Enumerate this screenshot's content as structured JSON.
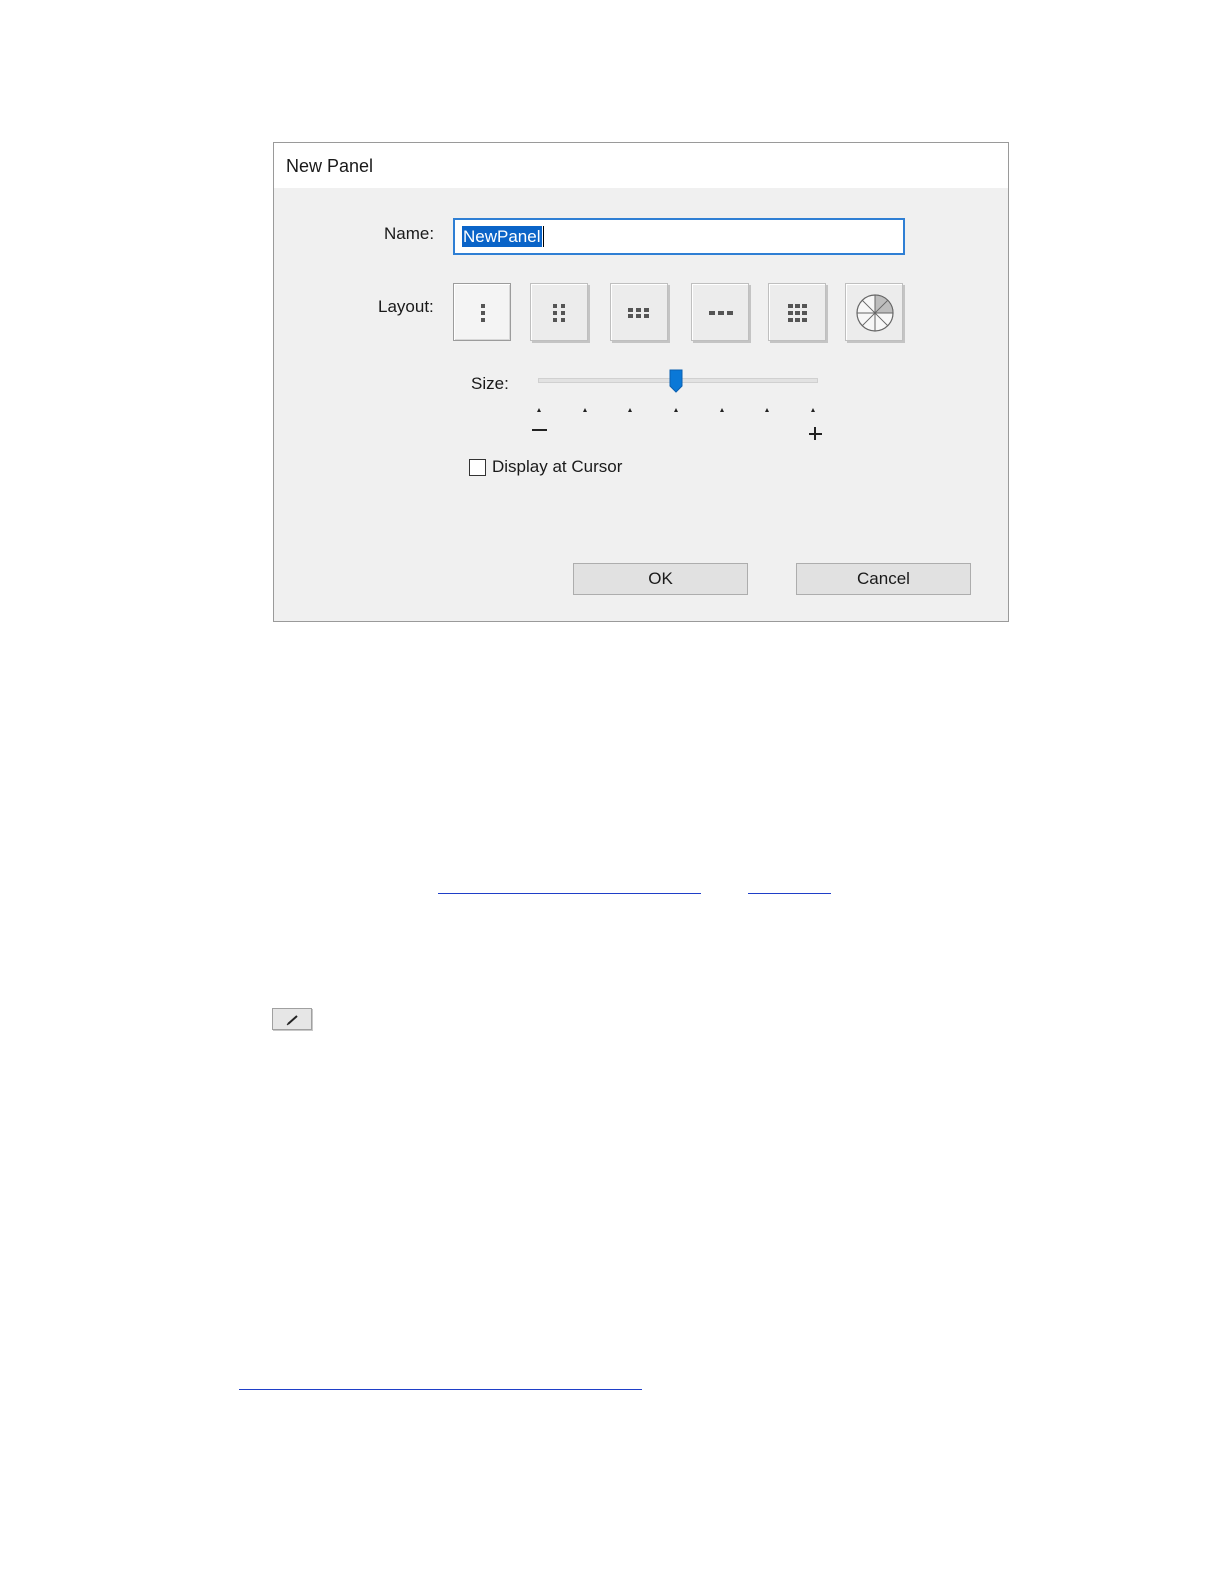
{
  "dialog": {
    "title": "New Panel",
    "name_label": "Name:",
    "name_value": "NewPanel",
    "layout_label": "Layout:",
    "layout_options": [
      {
        "name": "single-column",
        "icon": "single-column-icon",
        "selected": true
      },
      {
        "name": "two-column",
        "icon": "two-column-grid-icon",
        "selected": false
      },
      {
        "name": "three-column",
        "icon": "three-column-grid-icon",
        "selected": false
      },
      {
        "name": "single-row",
        "icon": "single-row-icon",
        "selected": false
      },
      {
        "name": "grid",
        "icon": "grid-icon",
        "selected": false
      },
      {
        "name": "radial",
        "icon": "radial-pie-icon",
        "selected": false
      }
    ],
    "size_label": "Size:",
    "size_slider": {
      "steps": 7,
      "current_step": 4
    },
    "display_at_cursor_label": "Display at Cursor",
    "display_at_cursor_checked": false,
    "ok_label": "OK",
    "cancel_label": "Cancel"
  },
  "below": {
    "hyperlinks": 3,
    "edit_button_icon": "pencil-icon"
  }
}
